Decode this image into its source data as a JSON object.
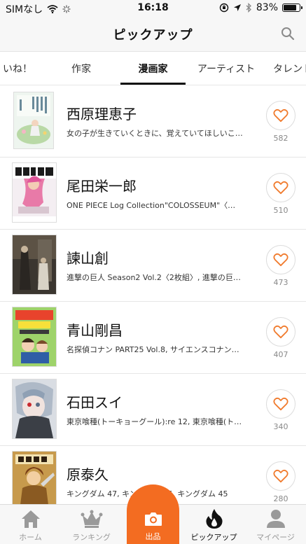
{
  "status_bar": {
    "carrier": "SIMなし",
    "time": "16:18",
    "battery_percent": "83%",
    "battery_level": 0.83
  },
  "header": {
    "title": "ピックアップ",
    "search_icon": "search-icon"
  },
  "tabs": [
    {
      "label": "いね！",
      "active": false
    },
    {
      "label": "作家",
      "active": false
    },
    {
      "label": "漫画家",
      "active": true
    },
    {
      "label": "アーティスト",
      "active": false
    },
    {
      "label": "タレント",
      "active": false
    }
  ],
  "creators": [
    {
      "name": "西原理恵子",
      "works": "女の子が生きていくときに、覚えていてほしいこ…",
      "likes": "582"
    },
    {
      "name": "尾田栄一郎",
      "works": "ONE PIECE Log Collection\"COLOSSEUM\"〈…",
      "likes": "510"
    },
    {
      "name": "諫山創",
      "works": "進撃の巨人 Season2 Vol.2〈2枚組〉, 進撃の巨…",
      "likes": "473"
    },
    {
      "name": "青山剛昌",
      "works": "名探偵コナン PART25 Vol.8, サイエンスコナン…",
      "likes": "407"
    },
    {
      "name": "石田スイ",
      "works": "東京喰種(トーキョーグール):re 12, 東京喰種(ト…",
      "likes": "340"
    },
    {
      "name": "原泰久",
      "works": "キングダム 47, キングダム 46, キングダム 45",
      "likes": "280"
    }
  ],
  "bottom_tabs": [
    {
      "label": "ホーム",
      "icon": "home-icon",
      "active": false
    },
    {
      "label": "ランキング",
      "icon": "crown-icon",
      "active": false
    },
    {
      "label": "出品",
      "icon": "camera-icon",
      "active": false
    },
    {
      "label": "ピックアップ",
      "icon": "flame-icon",
      "active": true
    },
    {
      "label": "マイページ",
      "icon": "person-icon",
      "active": false
    }
  ],
  "colors": {
    "accent": "#f36c21",
    "heart": "#f07a2c",
    "text": "#111111",
    "muted": "#888888"
  }
}
